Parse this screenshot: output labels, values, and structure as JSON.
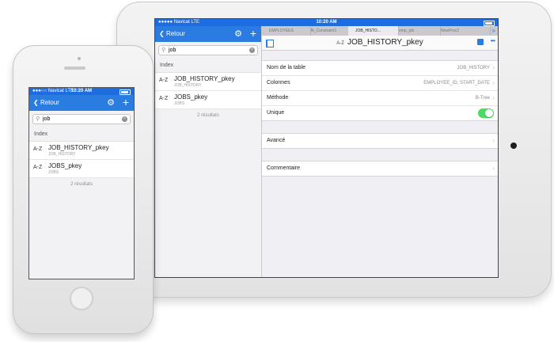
{
  "status": {
    "carrier": "●●●●● Navicat LTE",
    "time": "10:20 AM",
    "phone_carrier": "●●●○○ Navicat LTE"
  },
  "nav": {
    "back_label": "Retour"
  },
  "search": {
    "value": "job"
  },
  "index_section": "Index",
  "items": [
    {
      "icon": "A-Z",
      "title": "JOB_HISTORY_pkey",
      "subtitle": "JOB_HISTORY"
    },
    {
      "icon": "A-Z",
      "title": "JOBS_pkey",
      "subtitle": "JOBS"
    }
  ],
  "result_count": "2 résultats",
  "tabs": [
    "EMPLOYEES",
    "fk_Constraint1",
    "JOB_HISTO...",
    "emp_job",
    "NewProc2"
  ],
  "detail": {
    "title_prefix": "A-Z",
    "title": "JOB_HISTORY_pkey",
    "rows": [
      {
        "label": "Nom de la table",
        "value": "JOB_HISTORY"
      },
      {
        "label": "Colonnes",
        "value": "EMPLOYEE_ID, START_DATE"
      },
      {
        "label": "Méthode",
        "value": "B-Tree"
      }
    ],
    "unique_label": "Unique",
    "advanced_label": "Avancé",
    "comment_label": "Commentaire"
  },
  "colors": {
    "accent": "#2a7ce0",
    "toggle_on": "#4cd964"
  }
}
